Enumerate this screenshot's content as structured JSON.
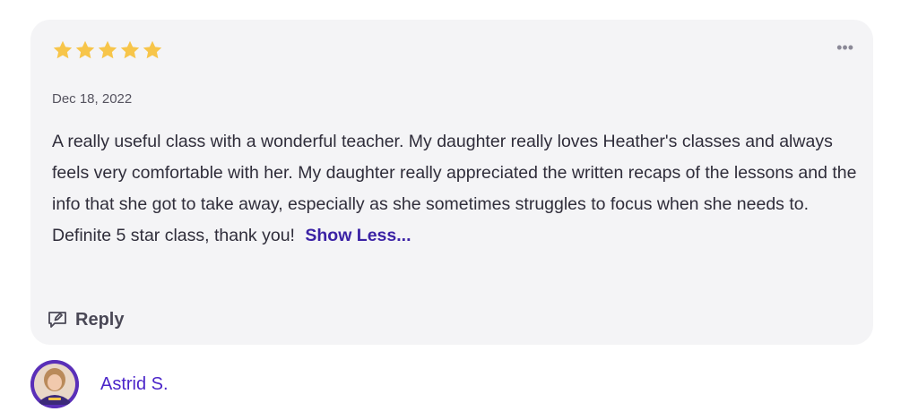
{
  "review": {
    "rating": 5,
    "rating_max": 5,
    "star_color": "#f7c54a",
    "more_label": "•••",
    "date": "Dec 18, 2022",
    "text": "A really useful class with a wonderful teacher. My daughter really loves Heather's classes and always feels very comfortable with her. My daughter really appreciated the written recaps of the lessons and the info that she got to take away, especially as she sometimes struggles to focus when she needs to. Definite 5 star class, thank you!",
    "show_less_label": "Show Less...",
    "reply_label": "Reply"
  },
  "reviewer": {
    "name": "Astrid S.",
    "avatar_icon": "user-photo",
    "accent_color": "#4b25c9"
  }
}
